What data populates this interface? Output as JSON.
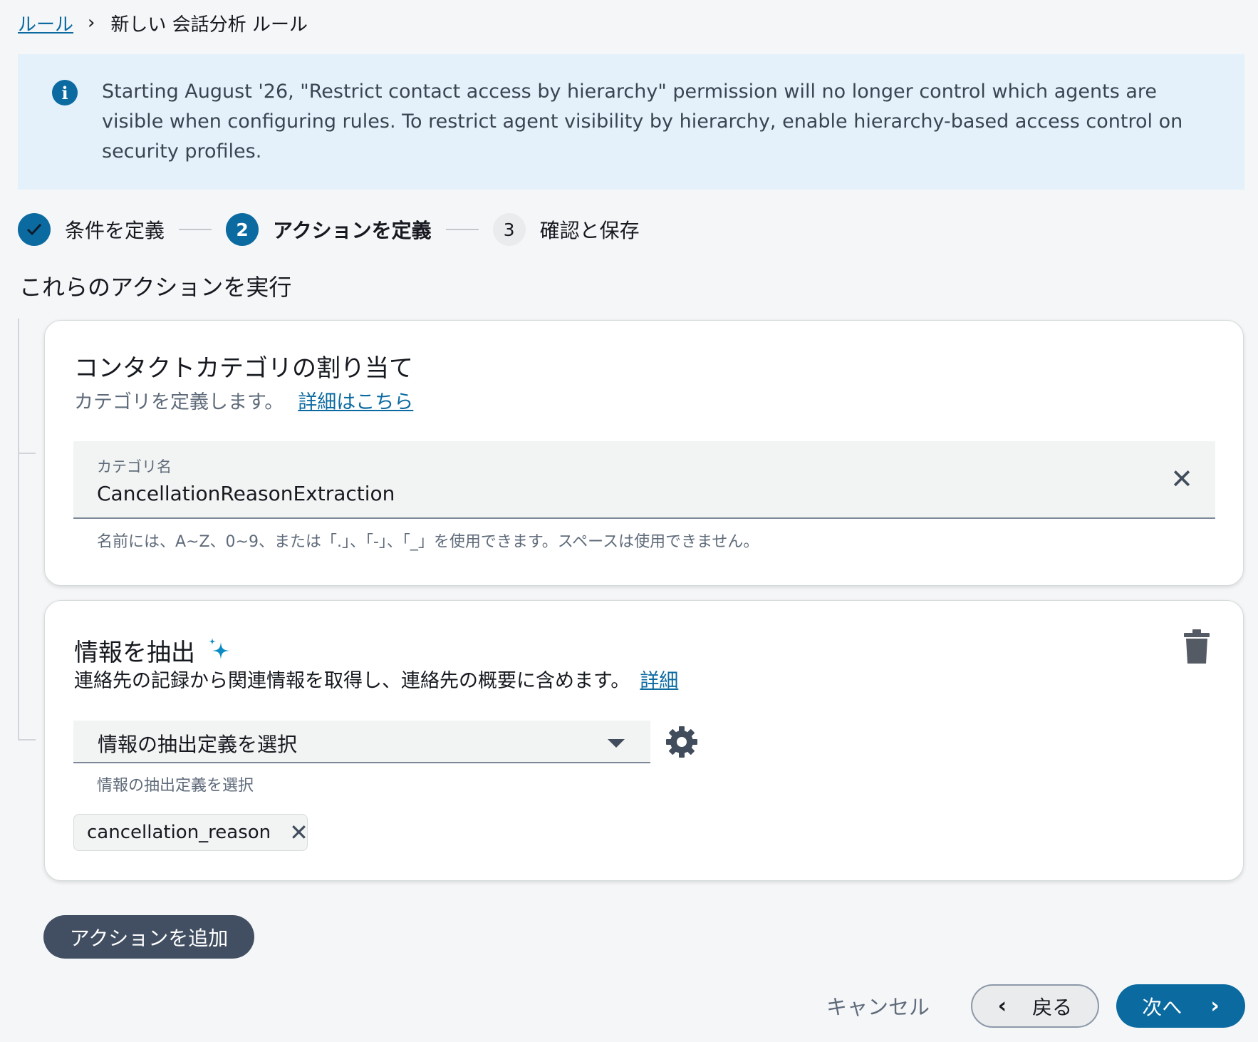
{
  "breadcrumb": {
    "root": "ルール",
    "current": "新しい 会話分析 ルール"
  },
  "banner": {
    "text": "Starting August '26, \"Restrict contact access by hierarchy\" permission will no longer control which agents are visible when configuring rules. To restrict agent visibility by hierarchy, enable hierarchy-based access control on security profiles.",
    "icon": "info-icon"
  },
  "stepper": {
    "steps": [
      {
        "label": "条件を定義",
        "state": "done"
      },
      {
        "label": "アクションを定義",
        "number": "2",
        "state": "current"
      },
      {
        "label": "確認と保存",
        "number": "3",
        "state": "todo"
      }
    ]
  },
  "section_title": "これらのアクションを実行",
  "card_category": {
    "title": "コンタクトカテゴリの割り当て",
    "description": "カテゴリを定義します。",
    "learn_more": "詳細はこちら",
    "field_label": "カテゴリ名",
    "field_value": "CancellationReasonExtraction",
    "hint": "名前には、A~Z、0~9、または「.」、「-」、「_」を使用できます。スペースは使用できません。"
  },
  "card_extract": {
    "title": "情報を抽出",
    "description": "連絡先の記録から関連情報を取得し、連絡先の概要に含めます。",
    "learn_more": "詳細",
    "select_value": "情報の抽出定義を選択",
    "select_hint": "情報の抽出定義を選択",
    "tokens": [
      "cancellation_reason"
    ]
  },
  "buttons": {
    "add_action": "アクションを追加",
    "cancel": "キャンセル",
    "back": "戻る",
    "next": "次へ"
  },
  "colors": {
    "accent": "#0b6aa0",
    "banner_bg": "#e4f1fb",
    "dark_button": "#424f62"
  }
}
